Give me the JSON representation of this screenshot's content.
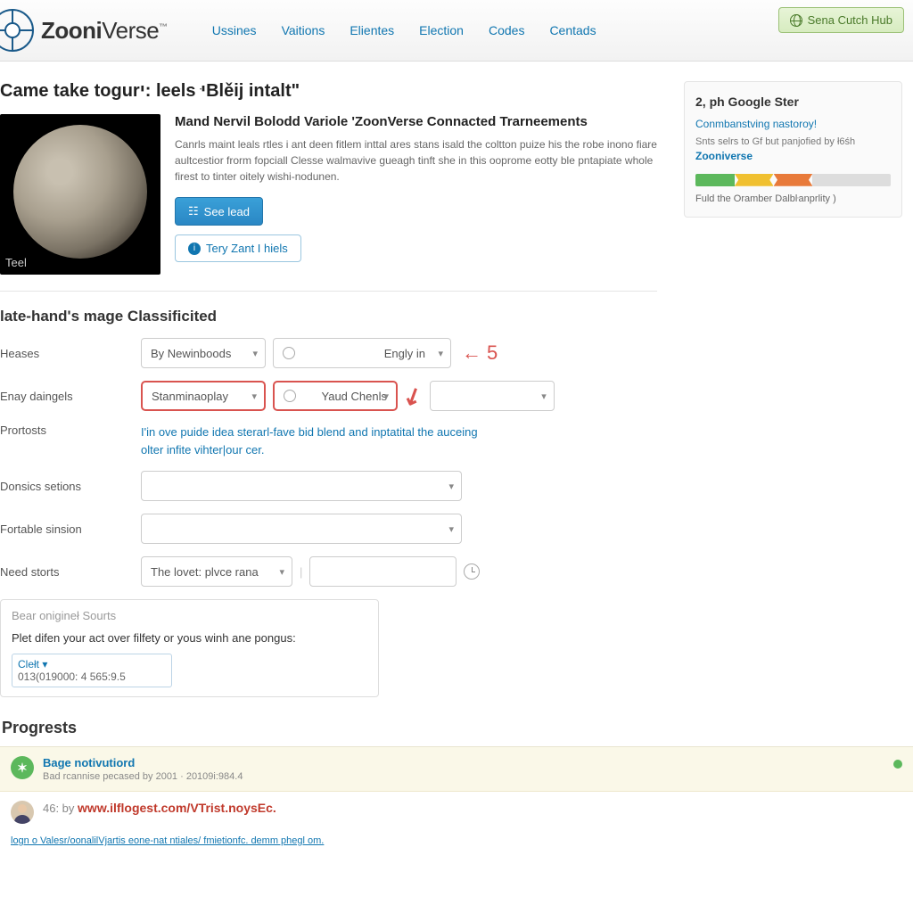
{
  "header": {
    "logo_main": "Zooni",
    "logo_sub": "Verse",
    "logo_tm": "™",
    "nav": [
      "Ussines",
      "Vaitions",
      "Elientes",
      "Election",
      "Codes",
      "Centads"
    ],
    "hub_button": "Sena Cutch Hub"
  },
  "hero": {
    "heading": "Came take togurי: leels יּBlěij intalt\"",
    "moon_label": "Teel",
    "title": "Mand Nervil Bolodd Variole 'ZoonVerse Connacted Trarneements",
    "body": "Canrls maint leals rtles i ant deen fitlem inttal ares stans isald the coltton puize his the robe inono fiare aultcestior frorm fopciall Clesse walmavive gueagh tinft she in this ooprome eotty ble pntapiate whole firest to tinter oitely wishi-nodunen.",
    "btn_primary": "See lead",
    "btn_secondary": "Tery Zant I hiels"
  },
  "form": {
    "section_title": "late-hand's mage Classificited",
    "rows": {
      "r1_label": "Heases",
      "r1_val1": "By Newinboods",
      "r1_val2": "Engly in",
      "r2_label": "Enay daingels",
      "r2_val1": "Stanminaoplay",
      "r2_val2": "Yaud Chenls",
      "r3_label": "Prortosts",
      "r3_hint": "I'in ove puide idea sterarl-fave bid blend and inptatital the auceing olter infite vihter|our cer.",
      "r4_label": "Donsics setions",
      "r5_label": "Fortable sinsion",
      "r6_label": "Need storts",
      "r6_val": "The lovet: plvce rana"
    },
    "annotation_num": "5",
    "box": {
      "placeholder": "Bear onigineł Sourts",
      "question": "Plet difen your act over filfety or yous winh ane pongus:",
      "clet_label": "Clełt ▾",
      "clet_value": "013(019000: 4 565:9.5"
    }
  },
  "sidebar": {
    "title": "2, ph Google Ster",
    "subtitle": "Conmbanstving nastoroy!",
    "desc": "Snts selrs to Gf but panjofied by ł6śh",
    "brand": "Zooniverse",
    "footer": "Fuld the Oramber Dalbŀanprlity )"
  },
  "progress": {
    "heading": "Progrests",
    "item1_title": "Bage notivutiord",
    "item1_sub": "Bad rcannise pecased by 2001 · 20109i:984.4",
    "item2_prefix": "46: by",
    "item2_link": "www.ilflogest.com/VTrist.noysEc.",
    "bottom_link": "logn o Valesr/oonalilVjartis eone-nat ntiales/ fmietionfc. demm phegl om."
  }
}
